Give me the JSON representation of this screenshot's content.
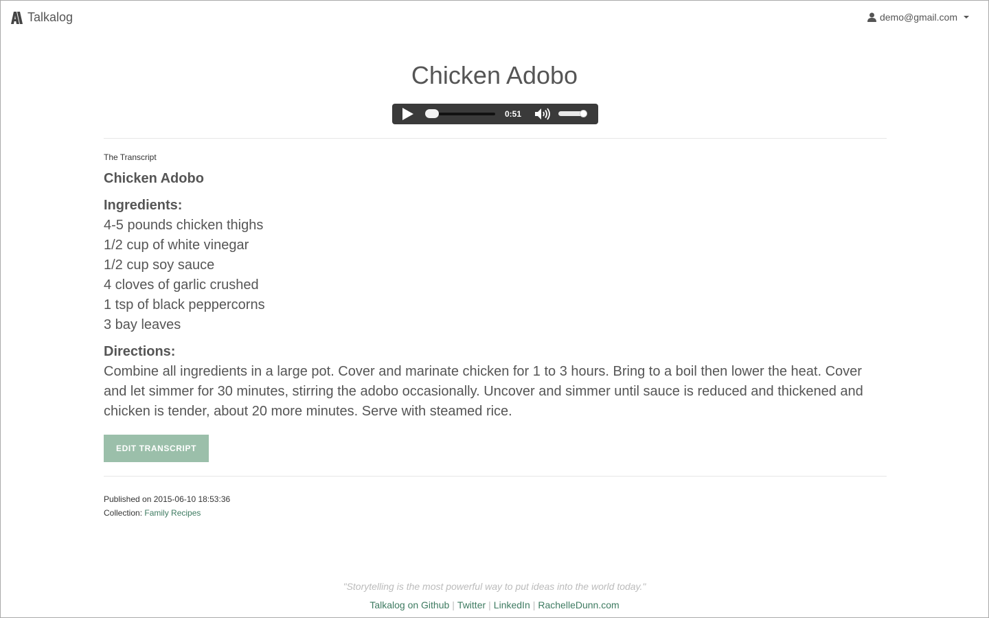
{
  "header": {
    "brand": "Talkalog",
    "user_email": "demo@gmail.com",
    "icons": {
      "brand": "talkalog-logo-icon",
      "user": "user-icon",
      "caret": "chevron-down-icon"
    }
  },
  "page": {
    "title": "Chicken Adobo"
  },
  "player": {
    "time": "0:51",
    "progress": 0.0,
    "volume": 1.0,
    "icons": {
      "play": "play-icon",
      "volume": "volume-icon"
    }
  },
  "transcript": {
    "label": "The Transcript",
    "heading": "Chicken Adobo",
    "ingredients_heading": "Ingredients:",
    "ingredients": [
      "4-5 pounds chicken thighs",
      "1/2 cup of white vinegar",
      "1/2 cup soy sauce",
      "4 cloves of garlic crushed",
      "1 tsp of black peppercorns",
      "3 bay leaves"
    ],
    "directions_heading": "Directions:",
    "directions": "Combine all ingredients in a large pot. Cover and marinate chicken for 1 to 3 hours. Bring to a boil then lower the heat. Cover and let simmer for 30 minutes, stirring the adobo occasionally. Uncover and simmer until sauce is reduced and thickened and chicken is tender, about 20 more minutes. Serve with steamed rice."
  },
  "actions": {
    "edit_label": "EDIT TRANSCRIPT"
  },
  "meta": {
    "published_prefix": "Published on ",
    "published_at": "2015-06-10 18:53:36",
    "collection_prefix": "Collection: ",
    "collection": "Family Recipes"
  },
  "footer": {
    "quote": "\"Storytelling is the most powerful way to put ideas into the world today.\"",
    "links": [
      "Talkalog on Github",
      "Twitter",
      "LinkedIn",
      "RachelleDunn.com"
    ],
    "separator": "|"
  },
  "colors": {
    "accent": "#3d7a60",
    "button": "#9bbfaa",
    "player_bg": "#3a3a3a"
  }
}
